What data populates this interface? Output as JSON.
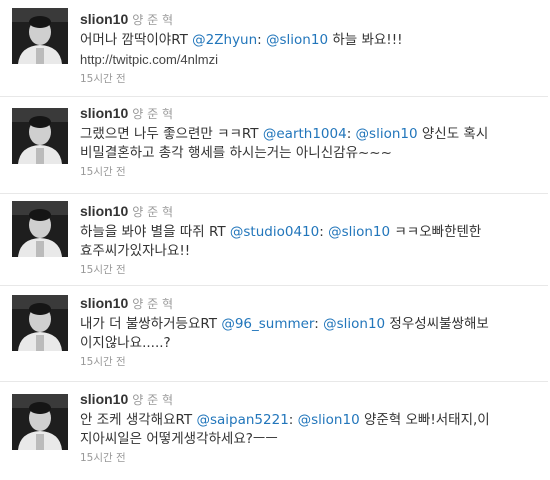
{
  "tweets": [
    {
      "screen_name": "slion10",
      "full_name": "양 준 혁",
      "line1_pre": "어머나 깜딱이야RT ",
      "line1_mention1": "@2Zhyun",
      "line1_mid": ": ",
      "line1_mention2": "@slion10",
      "line1_post": " 하늘 봐요!!!",
      "line2_link": "http://twitpic.com/4nlmzi",
      "timestamp": "15시간 전"
    },
    {
      "screen_name": "slion10",
      "full_name": "양 준 혁",
      "line1_pre": "그랬으면 나두 좋으련만 ㅋㅋRT ",
      "line1_mention1": "@earth1004",
      "line1_mid": ": ",
      "line1_mention2": "@slion10",
      "line1_post": " 양신도 혹시",
      "line2_text": "비밀결혼하고 총각 행세를 하시는거는 아니신감유~~~",
      "timestamp": "15시간 전"
    },
    {
      "screen_name": "slion10",
      "full_name": "양 준 혁",
      "line1_pre": "하늘을 봐야 별을 따쥐 RT ",
      "line1_mention1": "@studio0410",
      "line1_mid": ": ",
      "line1_mention2": "@slion10",
      "line1_post": " ㅋㅋ오빠한텐한",
      "line2_text": "효주씨가있자나요!!",
      "timestamp": "15시간 전"
    },
    {
      "screen_name": "slion10",
      "full_name": "양 준 혁",
      "line1_pre": "내가 더 불쌍하거등요RT ",
      "line1_mention1": "@96_summer",
      "line1_mid": ": ",
      "line1_mention2": "@slion10",
      "line1_post": " 정우성씨불쌍해보",
      "line2_text": "이지않나요.....?",
      "timestamp": "15시간 전"
    },
    {
      "screen_name": "slion10",
      "full_name": "양 준 혁",
      "line1_pre": "안 조케 생각해요RT ",
      "line1_mention1": "@saipan5221",
      "line1_mid": ": ",
      "line1_mention2": "@slion10",
      "line1_post": " 양준혁 오빠!서태지,이",
      "line2_text": "지아씨일은 어떻게생각하세요?ㅡㅡ",
      "timestamp": "15시간 전"
    }
  ]
}
